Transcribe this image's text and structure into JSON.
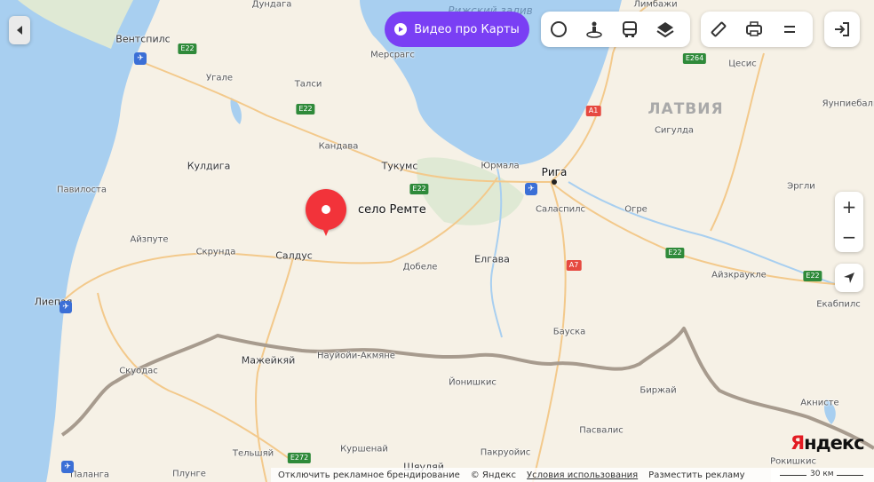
{
  "toolbar": {
    "video_label": "Видео про Карты",
    "buttons": [
      {
        "name": "traffic-button",
        "icon": "traffic-circle-icon"
      },
      {
        "name": "panorama-button",
        "icon": "street-view-icon"
      },
      {
        "name": "transit-button",
        "icon": "bus-icon"
      },
      {
        "name": "layers-button",
        "icon": "layers-icon"
      },
      {
        "name": "ruler-button",
        "icon": "ruler-icon"
      },
      {
        "name": "print-button",
        "icon": "printer-icon"
      },
      {
        "name": "menu-button",
        "icon": "menu-icon"
      },
      {
        "name": "login-button",
        "icon": "sign-in-icon"
      }
    ]
  },
  "search_pin": {
    "label": "село Ремте"
  },
  "colors": {
    "water": "#a8cff0",
    "land": "#f6f1e6",
    "forest": "#dfe9d4",
    "pin": "#f2333a",
    "video": "#7a3ff4",
    "border": "#a79b8e"
  },
  "map": {
    "water_label": "Рижский залив",
    "country": "ЛАТВИЯ",
    "cities": [
      {
        "name": "Дундага"
      },
      {
        "name": "Вентспилс"
      },
      {
        "name": "Мерсрагс"
      },
      {
        "name": "Угале"
      },
      {
        "name": "Талси"
      },
      {
        "name": "Кандава"
      },
      {
        "name": "Кулдига"
      },
      {
        "name": "Тукумс"
      },
      {
        "name": "Юрмала"
      },
      {
        "name": "Рига"
      },
      {
        "name": "Павилоста"
      },
      {
        "name": "Саласпилс"
      },
      {
        "name": "Огре"
      },
      {
        "name": "Айзпуте"
      },
      {
        "name": "Скрунда"
      },
      {
        "name": "Салдус"
      },
      {
        "name": "Добеле"
      },
      {
        "name": "Елгава"
      },
      {
        "name": "Лиепая"
      },
      {
        "name": "Скуодас"
      },
      {
        "name": "Мажейкяй"
      },
      {
        "name": "Науйойи-Акмяне"
      },
      {
        "name": "Йонишкис"
      },
      {
        "name": "Бауска"
      },
      {
        "name": "Биржай"
      },
      {
        "name": "Тельшяй"
      },
      {
        "name": "Куршенай"
      },
      {
        "name": "Пакруойис"
      },
      {
        "name": "Пасвалис"
      },
      {
        "name": "Плунге"
      },
      {
        "name": "Паланга"
      },
      {
        "name": "Шяуляй"
      },
      {
        "name": "Лимбажи"
      },
      {
        "name": "Цесис"
      },
      {
        "name": "Сигулда"
      },
      {
        "name": "Эргли"
      },
      {
        "name": "Айзкраукле"
      },
      {
        "name": "Екабпилс"
      },
      {
        "name": "Акнисте"
      },
      {
        "name": "Рокишкис"
      },
      {
        "name": "Яунпиебалга"
      }
    ],
    "roads": [
      "E22",
      "E22",
      "E22",
      "E22",
      "E22",
      "E264",
      "A1",
      "A7",
      "E272"
    ]
  },
  "zoom": {
    "in_label": "+",
    "out_label": "−"
  },
  "footer": {
    "disable_ads": "Отключить рекламное брендирование",
    "copyright": "© Яндекс",
    "terms": "Условия использования",
    "ads": "Разместить рекламу",
    "scale": "30 км"
  },
  "logo_text": "Яндекс"
}
